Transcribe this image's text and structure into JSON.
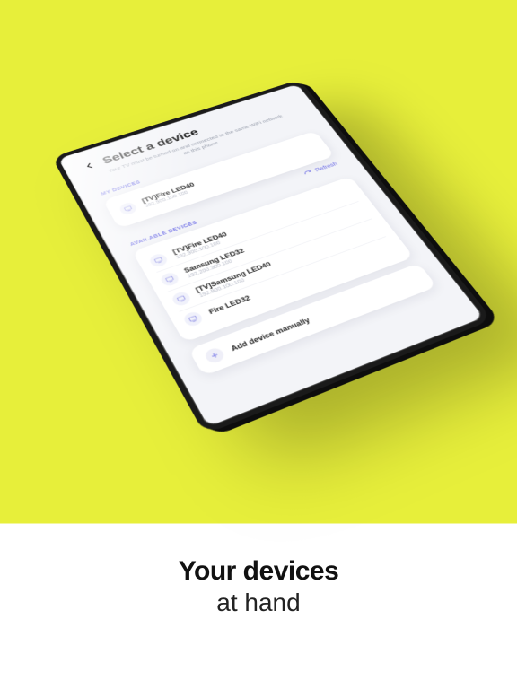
{
  "screen": {
    "title": "Select a device",
    "subtitle": "Your TV must be turned on and connected to the same WiFi network as this phone"
  },
  "sections": {
    "my_label": "MY DEVICES",
    "available_label": "AVAILABLE DEVICES"
  },
  "my_devices": [
    {
      "name": "[TV]Fire LED40",
      "ip": "192.900.100.100"
    }
  ],
  "refresh_label": "Refresh",
  "available_devices": [
    {
      "name": "[TV]Fire LED40",
      "ip": "192.900.100.100"
    },
    {
      "name": "Samsung LED32",
      "ip": "192.200.300.100"
    },
    {
      "name": "[TV]Samsung LED40",
      "ip": "192.900.100.100"
    },
    {
      "name": "Fire LED32",
      "ip": ""
    }
  ],
  "add_manual_label": "Add device manually",
  "marketing": {
    "line1": "Your devices",
    "line2": "at hand"
  }
}
